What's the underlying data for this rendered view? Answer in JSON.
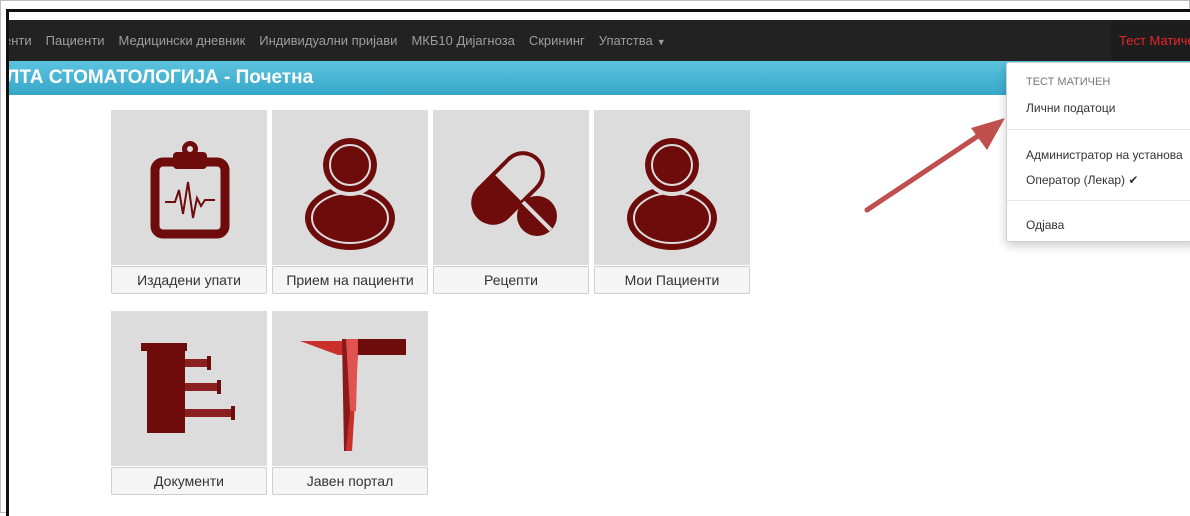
{
  "navbar": {
    "items": [
      "енти",
      "Пациенти",
      "Медицински дневник",
      "Индивидуални пријави",
      "МКБ10 Дијагноза",
      "Скрининг",
      "Упатства"
    ],
    "user_label": "Тест Матичен"
  },
  "header": {
    "title": "ЛТА СТОМАТОЛОГИЈА - Почетна"
  },
  "tiles": [
    {
      "label": "Издадени упати",
      "icon": "clipboard-ecg-icon"
    },
    {
      "label": "Прием на пациенти",
      "icon": "person-icon"
    },
    {
      "label": "Рецепти",
      "icon": "pills-icon"
    },
    {
      "label": "Мои Пациенти",
      "icon": "person-icon"
    },
    {
      "label": "Документи",
      "icon": "documents-icon"
    },
    {
      "label": "Јавен портал",
      "icon": "portal-t-icon"
    }
  ],
  "dropdown": {
    "header": "ТЕСТ МАТИЧЕН",
    "items": [
      "Лични податоци",
      "Администратор на установа",
      "Оператор (Лекар)",
      "Одјава"
    ],
    "checkmark": "✔"
  },
  "colors": {
    "navbar_bg": "#222222",
    "header_bg": "#3fb0d0",
    "icon_dark_red": "#6e0b0b",
    "icon_red": "#c9302c",
    "user_text": "#e8262a",
    "arrow": "#c0504d"
  }
}
